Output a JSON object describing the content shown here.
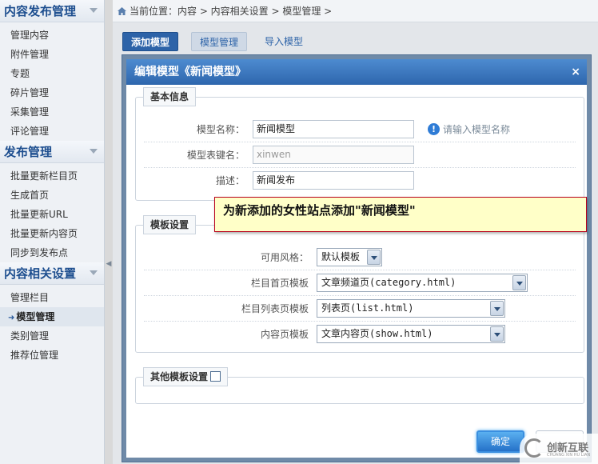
{
  "sidebar": {
    "sections": [
      {
        "title": "内容发布管理",
        "items": [
          "管理内容",
          "附件管理",
          "专题",
          "碎片管理",
          "采集管理",
          "评论管理"
        ]
      },
      {
        "title": "发布管理",
        "items": [
          "批量更新栏目页",
          "生成首页",
          "批量更新URL",
          "批量更新内容页",
          "同步到发布点"
        ]
      },
      {
        "title": "内容相关设置",
        "items": [
          "管理栏目",
          "模型管理",
          "类别管理",
          "推荐位管理"
        ]
      }
    ],
    "active_item": "模型管理"
  },
  "breadcrumb": {
    "text": "当前位置：内容 > 内容相关设置 > 模型管理 >"
  },
  "tabs": {
    "add": "添加模型",
    "manage": "模型管理",
    "import": "导入模型"
  },
  "dialog": {
    "title": "编辑模型《新闻模型》",
    "close": "×",
    "basic": {
      "legend": "基本信息",
      "name_label": "模型名称：",
      "name_value": "新闻模型",
      "name_hint": "请输入模型名称",
      "table_label": "模型表键名：",
      "table_value": "xinwen",
      "desc_label": "描述：",
      "desc_value": "新闻发布"
    },
    "template": {
      "legend": "模板设置",
      "style_label": "可用风格：",
      "style_value": "默认模板",
      "category_label": "栏目首页模板",
      "category_value": "文章频道页(category.html)",
      "list_label": "栏目列表页模板",
      "list_value": "列表页(list.html)",
      "show_label": "内容页模板",
      "show_value": "文章内容页(show.html)"
    },
    "other": {
      "legend": "其他模板设置"
    },
    "ok": "确定"
  },
  "tooltip": "为新添加的女性站点添加\"新闻模型\"",
  "watermark": {
    "text": "创新互联",
    "sub": "CHUANG XIN HU LIAN"
  }
}
